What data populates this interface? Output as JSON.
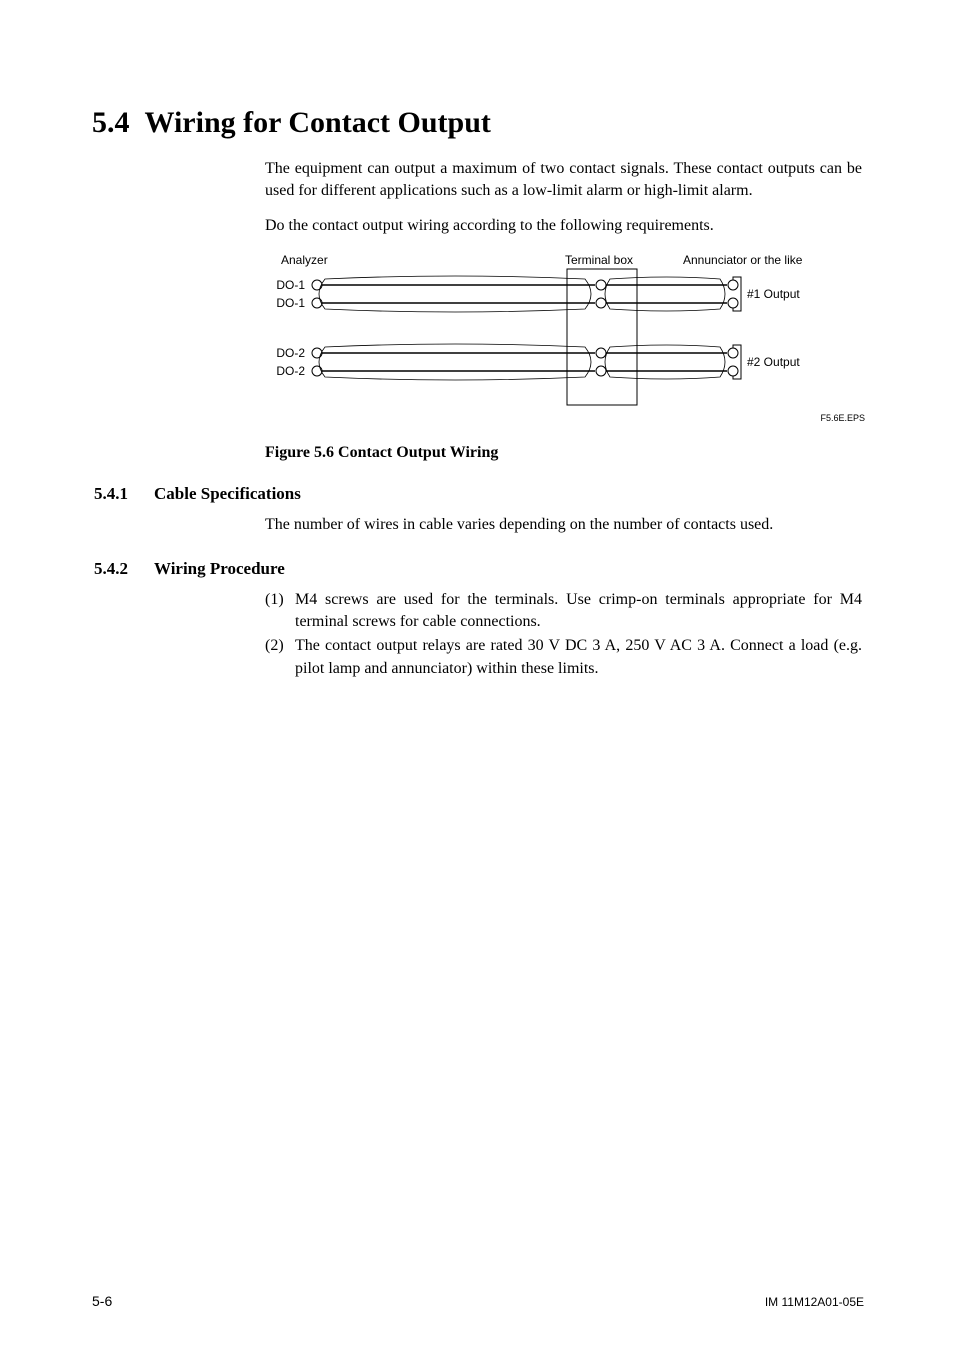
{
  "heading": {
    "number": "5.4",
    "title": "Wiring for Contact Output"
  },
  "paragraphs": {
    "intro1": "The equipment can output a maximum of two contact signals. These contact outputs can be used for different applications such as a low-limit alarm or high-limit alarm.",
    "intro2": "Do the contact output wiring according to the following requirements."
  },
  "figure": {
    "labels": {
      "analyzer": "Analyzer",
      "terminal_box": "Terminal box",
      "annunciator": "Annunciator or the like",
      "do1a": "DO-1",
      "do1b": "DO-1",
      "do2a": "DO-2",
      "do2b": "DO-2",
      "out1": "#1 Output",
      "out2": "#2 Output",
      "eps": "F5.6E.EPS"
    },
    "caption": "Figure 5.6   Contact Output Wiring"
  },
  "sub1": {
    "num": "5.4.1",
    "title": "Cable Specifications",
    "body": "The number of wires in cable varies depending on the number of contacts used."
  },
  "sub2": {
    "num": "5.4.2",
    "title": "Wiring Procedure",
    "items": {
      "n1": "(1)",
      "t1": "M4 screws are used for the terminals. Use crimp-on terminals appropriate for M4 terminal screws for cable connections.",
      "n2": "(2)",
      "t2": "The contact output relays are rated 30 V DC 3 A, 250 V AC 3 A. Connect a load (e.g. pilot lamp and annunciator) within these limits."
    }
  },
  "footer": {
    "page": "5-6",
    "docid": "IM 11M12A01-05E"
  }
}
